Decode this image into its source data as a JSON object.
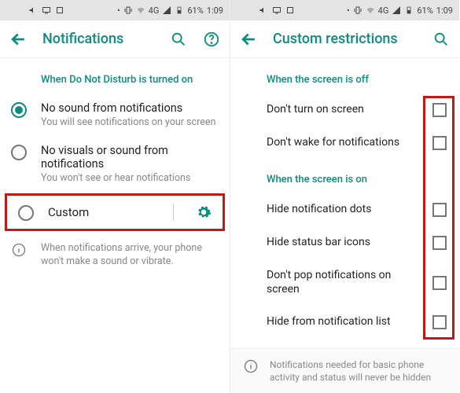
{
  "status": {
    "battery": "61%",
    "time": "1:09",
    "net": "4G"
  },
  "left": {
    "title": "Notifications",
    "section": "When Do Not Disturb is turned on",
    "opt1": {
      "title": "No sound from notifications",
      "sub": "You will see notifications on your screen"
    },
    "opt2": {
      "title": "No visuals or sound from notifications",
      "sub": "You won't see or hear notifications"
    },
    "opt3": {
      "title": "Custom"
    },
    "info": "When notifications arrive, your phone won't make a sound or vibrate."
  },
  "right": {
    "title": "Custom restrictions",
    "sectionOff": "When the screen is off",
    "off1": "Don't turn on screen",
    "off2": "Don't wake for notifications",
    "sectionOn": "When the screen is on",
    "on1": "Hide notification dots",
    "on2": "Hide status bar icons",
    "on3": "Don't pop notifications on screen",
    "on4": "Hide from notification list",
    "footer": "Notifications needed for basic phone activity and status will never be hidden"
  }
}
